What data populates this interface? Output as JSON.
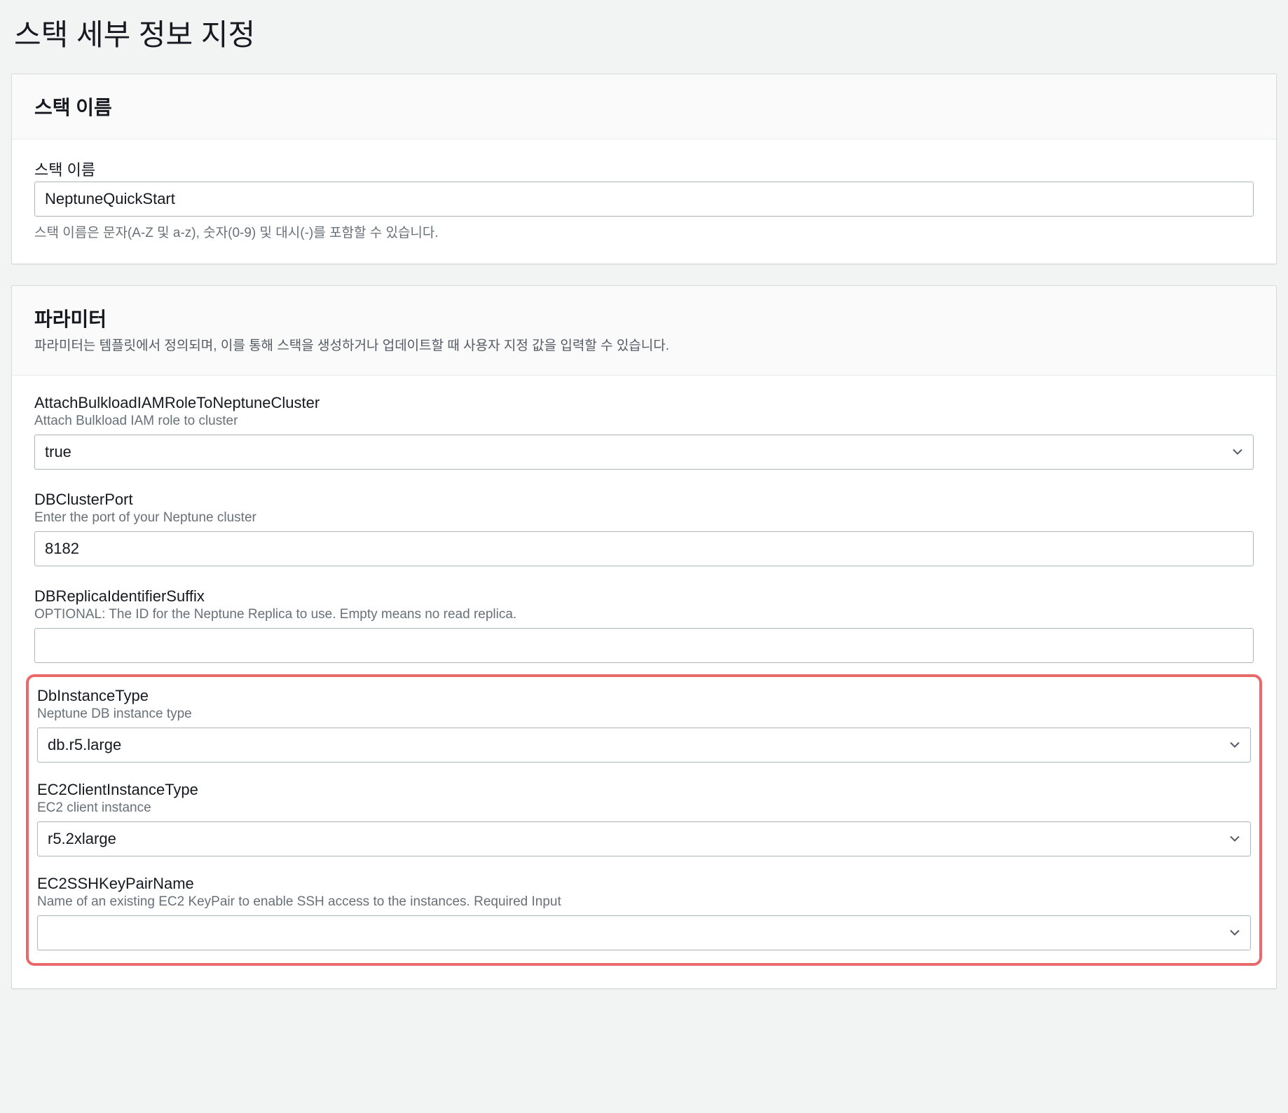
{
  "page": {
    "title": "스택 세부 정보 지정"
  },
  "stackName": {
    "panelTitle": "스택 이름",
    "label": "스택 이름",
    "value": "NeptuneQuickStart",
    "hint": "스택 이름은 문자(A-Z 및 a-z), 숫자(0-9) 및 대시(-)를 포함할 수 있습니다."
  },
  "parameters": {
    "panelTitle": "파라미터",
    "panelSubtitle": "파라미터는 템플릿에서 정의되며, 이를 통해 스택을 생성하거나 업데이트할 때 사용자 지정 값을 입력할 수 있습니다.",
    "attachBulkload": {
      "label": "AttachBulkloadIAMRoleToNeptuneCluster",
      "help": "Attach Bulkload IAM role to cluster",
      "value": "true"
    },
    "dbClusterPort": {
      "label": "DBClusterPort",
      "help": "Enter the port of your Neptune cluster",
      "value": "8182"
    },
    "dbReplicaIdSuffix": {
      "label": "DBReplicaIdentifierSuffix",
      "help": "OPTIONAL: The ID for the Neptune Replica to use. Empty means no read replica.",
      "value": ""
    },
    "dbInstanceType": {
      "label": "DbInstanceType",
      "help": "Neptune DB instance type",
      "value": "db.r5.large"
    },
    "ec2ClientInstanceType": {
      "label": "EC2ClientInstanceType",
      "help": "EC2 client instance",
      "value": "r5.2xlarge"
    },
    "ec2SSHKeyPairName": {
      "label": "EC2SSHKeyPairName",
      "help": "Name of an existing EC2 KeyPair to enable SSH access to the instances. Required Input",
      "value": ""
    }
  }
}
